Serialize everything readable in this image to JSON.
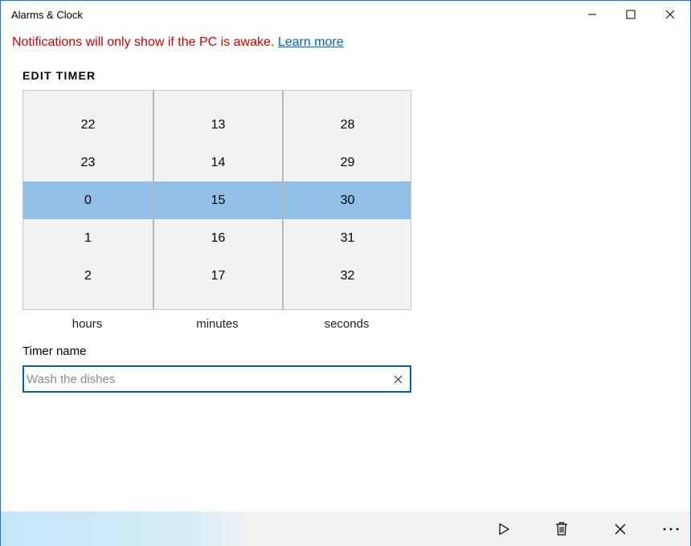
{
  "window": {
    "title": "Alarms & Clock"
  },
  "notice": {
    "text": "Notifications will only show if the PC is awake.",
    "link": "Learn more",
    "color": "#d00000",
    "link_color": "#0063b1"
  },
  "editor": {
    "heading": "EDIT TIMER",
    "columns": [
      {
        "unit": "hours",
        "values": [
          "22",
          "23",
          "0",
          "1",
          "2"
        ]
      },
      {
        "unit": "minutes",
        "values": [
          "13",
          "14",
          "15",
          "16",
          "17"
        ]
      },
      {
        "unit": "seconds",
        "values": [
          "28",
          "29",
          "30",
          "31",
          "32"
        ]
      }
    ],
    "selected_color": "#91bfe8",
    "name_label": "Timer name",
    "name_value": "",
    "name_placeholder": "Wash the dishes"
  },
  "command_bar": {
    "icons": [
      "play-icon",
      "trash-icon",
      "close-icon",
      "more-icon"
    ]
  }
}
